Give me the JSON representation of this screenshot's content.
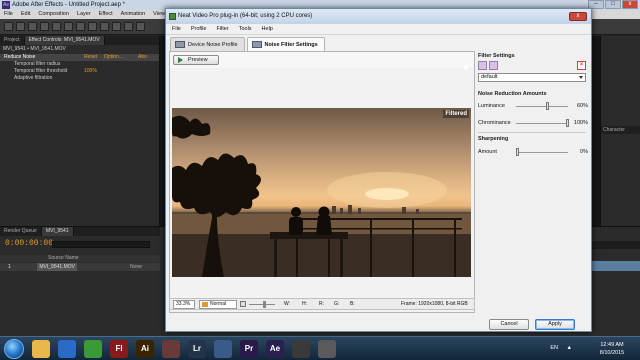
{
  "after_effects": {
    "title": "Adobe After Effects - Untitled Project.aep *",
    "menu": [
      "File",
      "Edit",
      "Composition",
      "Layer",
      "Effect",
      "Animation",
      "View"
    ],
    "project_tabs": [
      "Project",
      "Effect Controls: MVI_9541.MOV"
    ],
    "comp_path": "MVI_9541 • MVI_9541.MOV",
    "effect": {
      "name": "Reduce Noise",
      "reset": "Reset",
      "options": "Option...",
      "about": "Abo",
      "rows": [
        {
          "label": "Temporal filter radius",
          "value": ""
        },
        {
          "label": "Temporal filter threshold",
          "value": "100%"
        },
        {
          "label": "Adaptive filtration",
          "value": ""
        }
      ]
    },
    "timeline_tabs": [
      "Render Queue",
      "MVI_9541"
    ],
    "timecode": "0:00:00:00",
    "layer": {
      "num": "1",
      "name": "MVI_9541.MOV",
      "parent": "None"
    },
    "source_name_header": "Source Name",
    "right_tab": "Character"
  },
  "neat_video": {
    "title": "Neat Video Pro plug-in (64-bit; using 2 CPU cores)",
    "close_label": "x",
    "menu": [
      "File",
      "Profile",
      "Filter",
      "Tools",
      "Help"
    ],
    "tabs": [
      {
        "label": "Device Noise Profile",
        "active": false
      },
      {
        "label": "Noise Filter Settings",
        "active": true
      }
    ],
    "preview_button": "Preview",
    "preview_badge": "Filtered",
    "status": {
      "zoom": "33.3%",
      "mode": "Normal",
      "w_label": "W:",
      "h_label": "H:",
      "r_label": "R:",
      "g_label": "G:",
      "b_label": "B:",
      "frame": "Frame: 1920x1080, 8-bit RGB"
    },
    "filter_settings": {
      "heading": "Filter Settings",
      "preset": "default"
    },
    "noise_reduction": {
      "heading": "Noise Reduction Amounts",
      "luminance_label": "Luminance",
      "luminance_value": "60%",
      "luminance_level": 0.6,
      "chrominance_label": "Chrominance",
      "chrominance_value": "100%",
      "chrominance_level": 1.0
    },
    "sharpening": {
      "heading": "Sharpening",
      "amount_label": "Amount",
      "amount_value": "0%",
      "amount_level": 0.0
    },
    "cancel_button": "Cancel",
    "apply_button": "Apply"
  },
  "taskbar": {
    "apps": [
      {
        "icon": "explorer-icon",
        "label": "",
        "color": "#e8b84a"
      },
      {
        "icon": "media-player-icon",
        "label": "",
        "color": "#2a6ac8"
      },
      {
        "icon": "chrome-icon",
        "label": "",
        "color": "#3a9a3a"
      },
      {
        "icon": "flash-icon",
        "label": "Fl",
        "color": "#8a1a1a"
      },
      {
        "icon": "illustrator-icon",
        "label": "Ai",
        "color": "#3a2400"
      },
      {
        "icon": "app-icon",
        "label": "",
        "color": "#6a3a3a"
      },
      {
        "icon": "lightroom-icon",
        "label": "Lr",
        "color": "#233448"
      },
      {
        "icon": "media-icon",
        "label": "",
        "color": "#3a5a8a"
      },
      {
        "icon": "premiere-icon",
        "label": "Pr",
        "color": "#2a1a4a"
      },
      {
        "icon": "after-effects-icon",
        "label": "Ae",
        "color": "#2a2050"
      },
      {
        "icon": "app-icon",
        "label": "",
        "color": "#3a3a3a"
      },
      {
        "icon": "app-icon",
        "label": "",
        "color": "#5a5a5a"
      }
    ],
    "lang": "EN",
    "time": "12:49 AM",
    "date": "8/10/2015"
  }
}
